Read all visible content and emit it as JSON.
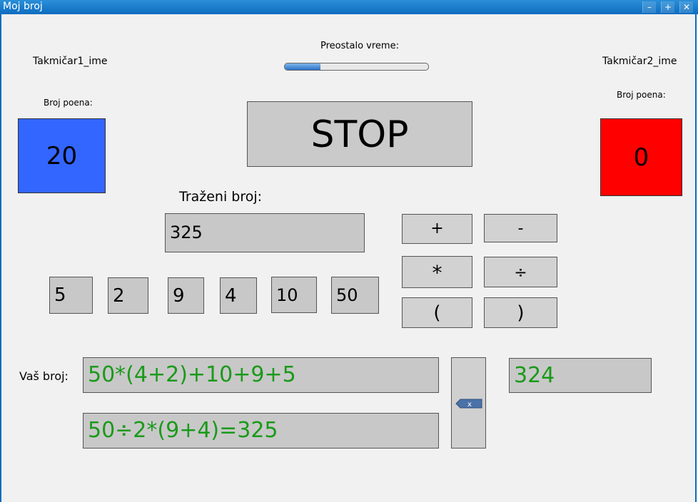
{
  "window": {
    "title": "Moj broj",
    "minimize_icon": "minimize-icon",
    "maximize_icon": "plus-icon",
    "close_icon": "close-icon"
  },
  "timer": {
    "label": "Preostalo vreme:",
    "progress_percent": 25
  },
  "player1": {
    "name": "Takmičar1_ime",
    "points_label": "Broj poena:",
    "points": "20",
    "color": "#3366ff"
  },
  "player2": {
    "name": "Takmičar2_ime",
    "points_label": "Broj poena:",
    "points": "0",
    "color": "#ff0000"
  },
  "stop_button": {
    "label": "STOP"
  },
  "target": {
    "label": "Traženi broj:",
    "value": "325"
  },
  "numbers": [
    "5",
    "2",
    "9",
    "4",
    "10",
    "50"
  ],
  "operators": [
    "+",
    "-",
    "*",
    "÷",
    "(",
    ")"
  ],
  "your_number": {
    "label": "Vaš broj:",
    "expression1": "50*(4+2)+10+9+5",
    "expression2": "50÷2*(9+4)=325",
    "result": "324",
    "backspace_label": "x",
    "text_color": "#1a9a1a"
  }
}
